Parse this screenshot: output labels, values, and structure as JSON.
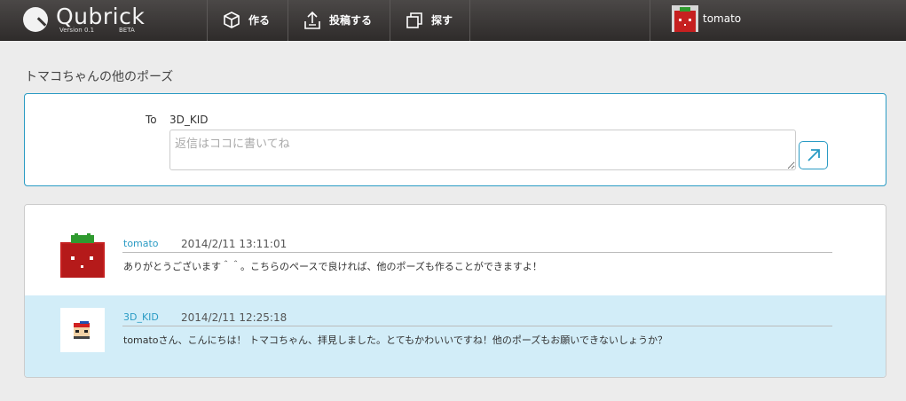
{
  "app": {
    "logo_text": "Qubrick",
    "version": "Version 0.1",
    "beta": "BETA"
  },
  "nav": {
    "make": "作る",
    "post": "投稿する",
    "find": "探す",
    "user": "tomato"
  },
  "page": {
    "title": "トマコちゃんの他のポーズ"
  },
  "reply": {
    "to_label": "To",
    "to_value": "3D_KID",
    "placeholder": "返信はココに書いてね"
  },
  "messages": [
    {
      "author": "tomato",
      "time": "2014/2/11 13:11:01",
      "body": "ありがとうございます＾＾。こちらのペースで良ければ、他のポーズも作ることができますよ！"
    },
    {
      "author": "3D_KID",
      "time": "2014/2/11 12:25:18",
      "body": "tomatoさん、こんにちは！ トマコちゃん、拝見しました。とてもかわいいですね！他のポーズもお願いできないしょうか？"
    }
  ],
  "colors": {
    "accent": "#2a9bc4",
    "highlight_row": "#d2edf8",
    "header": "#3a3736"
  }
}
